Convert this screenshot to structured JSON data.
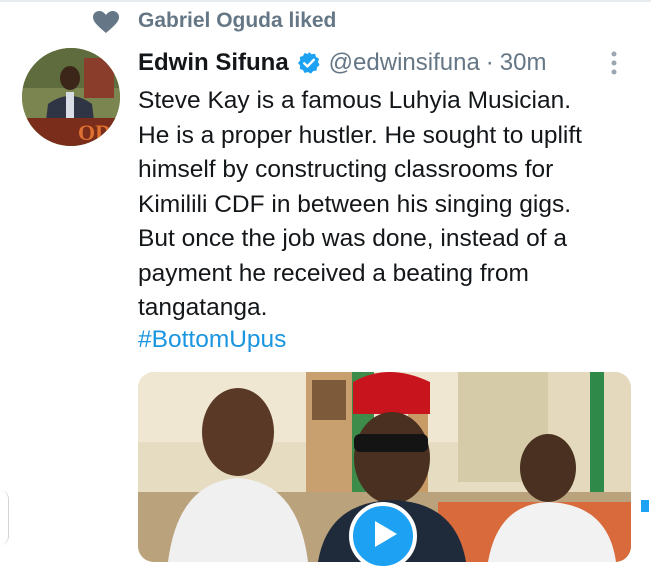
{
  "social_context": {
    "icon": "heart-icon",
    "text": "Gabriel Oguda liked"
  },
  "tweet": {
    "author_name": "Edwin Sifuna",
    "verified": true,
    "handle": "@edwinsifuna",
    "separator": "·",
    "time": "30m",
    "text": "Steve Kay is a famous Luhyia Musician.\nHe is a proper hustler. He sought to uplift\nhimself by constructing classrooms for\nKimilili CDF in between his singing gigs.\nBut once the job was done, instead of a\npayment he received a beating from\ntangatanga.",
    "hashtag": "#BottomUpus",
    "avatar_overlay_text": "OD"
  },
  "colors": {
    "accent": "#1da1f2",
    "muted": "#657786",
    "text": "#14171a"
  }
}
